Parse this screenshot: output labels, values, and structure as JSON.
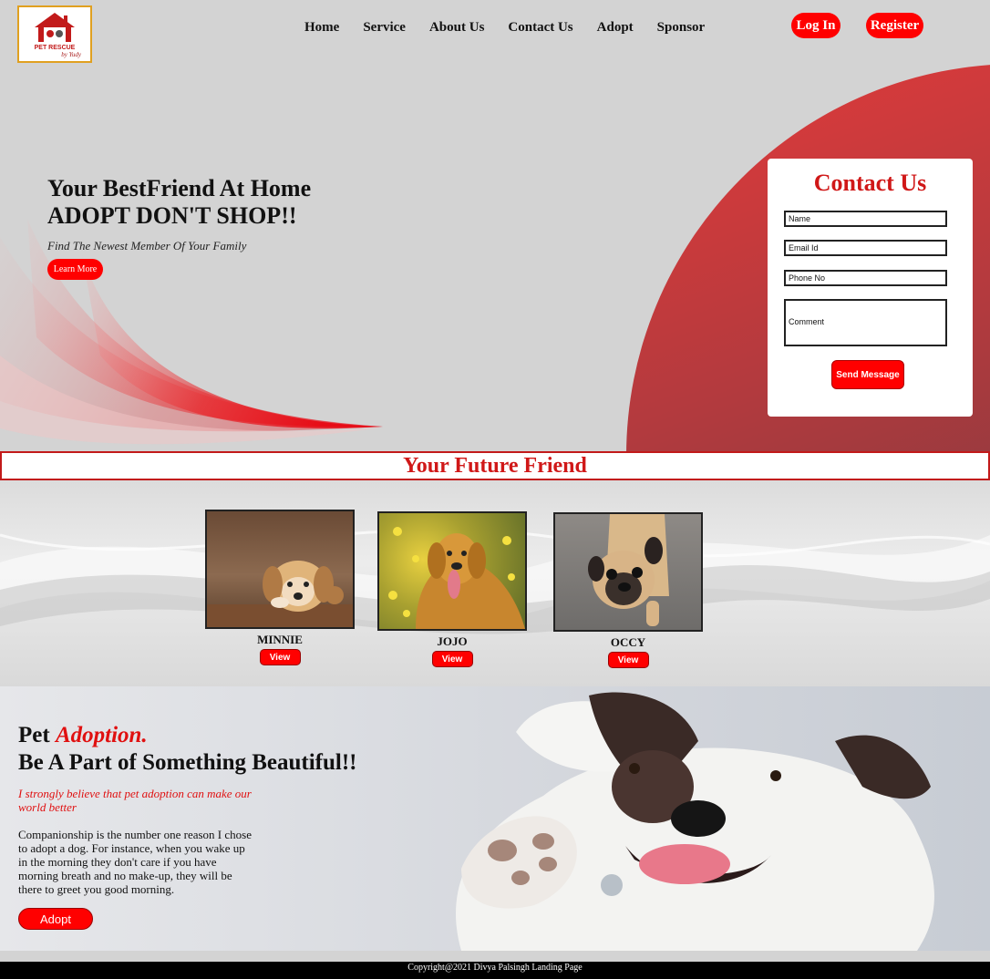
{
  "header": {
    "logo": {
      "line1": "PET RESCUE",
      "line2": "by Yudy"
    },
    "nav": [
      "Home",
      "Service",
      "About Us",
      "Contact Us",
      "Adopt",
      "Sponsor"
    ],
    "login_label": "Log In",
    "register_label": "Register"
  },
  "hero": {
    "title_line1": "Your BestFriend At Home",
    "title_line2": "ADOPT DON'T SHOP!!",
    "subtitle": "Find The Newest Member Of Your Family",
    "cta_label": "Learn More"
  },
  "contact": {
    "title": "Contact Us",
    "name_placeholder": "Name",
    "email_placeholder": "Email Id",
    "phone_placeholder": "Phone No",
    "comment_placeholder": "Comment",
    "submit_label": "Send Message"
  },
  "future_friend": {
    "title": "Your Future Friend",
    "pets": [
      {
        "name": "MINNIE",
        "view_label": "View"
      },
      {
        "name": "JOJO",
        "view_label": "View"
      },
      {
        "name": "OCCY",
        "view_label": "View"
      }
    ]
  },
  "adoption": {
    "heading_plain": "Pet",
    "heading_accent": "Adoption.",
    "subheading": "Be A Part of Something Beautiful!!",
    "quote": "I strongly believe that pet adoption can make our world better",
    "body": "Companionship is the number one reason I chose to adopt a dog. For instance, when you wake up in the morning they don't care if you have morning breath and no make-up, they will be there to greet you good morning.",
    "cta_label": "Adopt"
  },
  "footer": {
    "text": "Copyright@2021 Divya Palsingh Landing Page"
  },
  "colors": {
    "accent": "#ff0000",
    "brand_red": "#d01818"
  }
}
